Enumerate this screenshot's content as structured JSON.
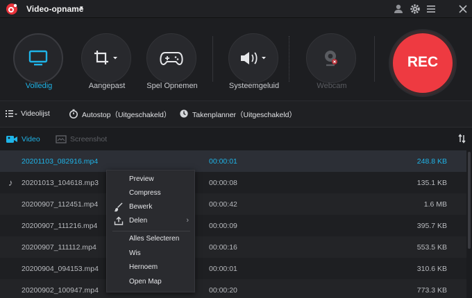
{
  "app": {
    "title": "Video-opname",
    "title_caret": "▾",
    "brand_color": "#e8323a",
    "accent_color": "#1fb4e8"
  },
  "titlebar_icons": [
    "user-icon",
    "gear-icon",
    "menu-icon",
    "close-icon"
  ],
  "toolbar": {
    "volledig": "Volledig",
    "aangepast": "Aangepast",
    "spel_opnemen": "Spel Opnemen",
    "systeemgeluid": "Systeemgeluid",
    "webcam": "Webcam",
    "rec": "REC"
  },
  "status": {
    "videolijst": "Videolijst",
    "autostop": "Autostop（Uitgeschakeld）",
    "takenplanner": "Takenplanner（Uitgeschakeld）"
  },
  "tabs": {
    "video": "Video",
    "screenshot": "Screenshot"
  },
  "files": [
    {
      "name": "20201103_082916.mp4",
      "duration": "00:00:01",
      "size": "248.8 KB"
    },
    {
      "name": "20201013_104618.mp3",
      "duration": "00:00:08",
      "size": "135.1 KB"
    },
    {
      "name": "20200907_112451.mp4",
      "duration": "00:00:42",
      "size": "1.6 MB"
    },
    {
      "name": "20200907_111216.mp4",
      "duration": "00:00:09",
      "size": "395.7 KB"
    },
    {
      "name": "20200907_111112.mp4",
      "duration": "00:00:16",
      "size": "553.5 KB"
    },
    {
      "name": "20200904_094153.mp4",
      "duration": "00:00:01",
      "size": "310.6 KB"
    },
    {
      "name": "20200902_100947.mp4",
      "duration": "00:00:20",
      "size": "773.3 KB"
    }
  ],
  "context_menu": {
    "preview": "Preview",
    "compress": "Compress",
    "bewerk": "Bewerk",
    "delen": "Delen",
    "alles_selecteren": "Alles Selecteren",
    "wis": "Wis",
    "hernoem": "Hernoem",
    "open_map": "Open Map",
    "submenu_arrow": "›"
  }
}
